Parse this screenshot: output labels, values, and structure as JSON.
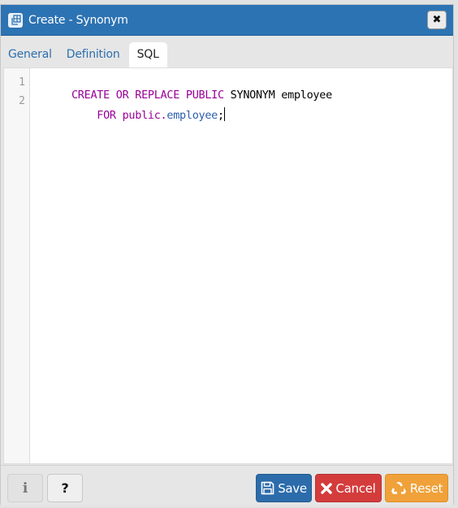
{
  "dialog": {
    "title": "Create - Synonym",
    "title_icon": "synonym-table-icon",
    "close_icon": "close-icon",
    "close_glyph": "✖"
  },
  "tabs": [
    {
      "label": "General",
      "active": false
    },
    {
      "label": "Definition",
      "active": false
    },
    {
      "label": "SQL",
      "active": true
    }
  ],
  "editor": {
    "line_numbers": [
      "1",
      "2"
    ],
    "lines": [
      [
        {
          "text": "CREATE OR REPLACE PUBLIC",
          "type": "keyword"
        },
        {
          "text": " SYNONYM employee",
          "type": "plain"
        }
      ],
      [
        {
          "text": "    FOR",
          "type": "keyword"
        },
        {
          "text": " public.",
          "type": "keyword"
        },
        {
          "text": "employee",
          "type": "property"
        },
        {
          "text": ";",
          "type": "plain"
        }
      ]
    ],
    "colors": {
      "keyword": "#990099",
      "property": "#2a5db0",
      "plain": "#000000"
    }
  },
  "footer": {
    "info_glyph": "i",
    "help_glyph": "?",
    "save_label": "Save",
    "cancel_label": "Cancel",
    "reset_label": "Reset",
    "save_icon": "floppy-disk-icon",
    "cancel_icon": "x-icon",
    "reset_icon": "recycle-icon",
    "colors": {
      "save": "#2c6cab",
      "cancel": "#d43c3c",
      "reset": "#f0a13a"
    }
  }
}
